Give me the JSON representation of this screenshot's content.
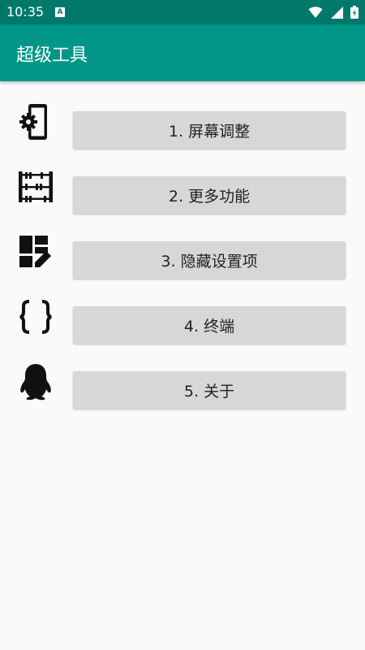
{
  "status_bar": {
    "time": "10:35",
    "notification_icon": "A",
    "icons": [
      "wifi-icon",
      "signal-icon",
      "battery-icon"
    ]
  },
  "app_bar": {
    "title": "超级工具",
    "color": "#009688",
    "status_color": "#00796b"
  },
  "menu": {
    "items": [
      {
        "label": "1. 屏幕调整",
        "icon": "phone-settings-icon"
      },
      {
        "label": "2. 更多功能",
        "icon": "abacus-icon"
      },
      {
        "label": "3. 隐藏设置项",
        "icon": "dashboard-edit-icon"
      },
      {
        "label": "4. 终端",
        "icon": "code-braces-icon"
      },
      {
        "label": "5. 关于",
        "icon": "qq-penguin-icon"
      }
    ]
  }
}
